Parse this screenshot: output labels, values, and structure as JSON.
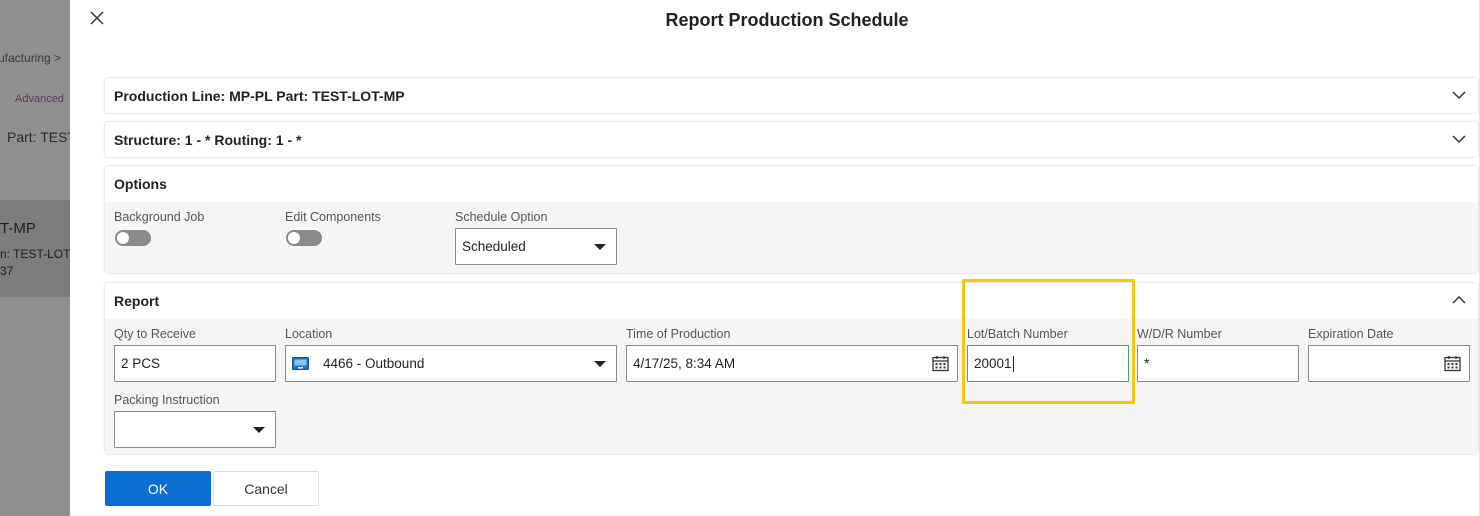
{
  "background": {
    "breadcrumb": "ufacturing  >",
    "advanced_label": "Advanced",
    "part_label": "Part: TEST",
    "card_title": "T-MP",
    "card_line1": "n:   TEST-LOT",
    "card_line2": "37"
  },
  "dialog": {
    "title": "Report Production Schedule"
  },
  "sections": {
    "production_line": {
      "title": "Production Line: MP-PL Part: TEST-LOT-MP"
    },
    "structure": {
      "title": "Structure: 1 - * Routing: 1 - *"
    },
    "options": {
      "title": "Options",
      "background_job_label": "Background Job",
      "edit_components_label": "Edit Components",
      "schedule_option_label": "Schedule Option",
      "schedule_option_value": "Scheduled"
    },
    "report": {
      "title": "Report",
      "qty_label": "Qty to Receive",
      "qty_value": "2 PCS",
      "location_label": "Location",
      "location_value": "4466 - Outbound",
      "time_label": "Time of Production",
      "time_value": "4/17/25, 8:34 AM",
      "lot_label": "Lot/Batch Number",
      "lot_value": "20001",
      "wdr_label": "W/D/R Number",
      "wdr_value": "*",
      "expiration_label": "Expiration Date",
      "expiration_value": "",
      "packing_label": "Packing Instruction",
      "packing_value": ""
    }
  },
  "buttons": {
    "ok": "OK",
    "cancel": "Cancel"
  },
  "colors": {
    "primary": "#0a6fd0",
    "highlight": "#f5c518",
    "focus": "#3fa56b"
  }
}
